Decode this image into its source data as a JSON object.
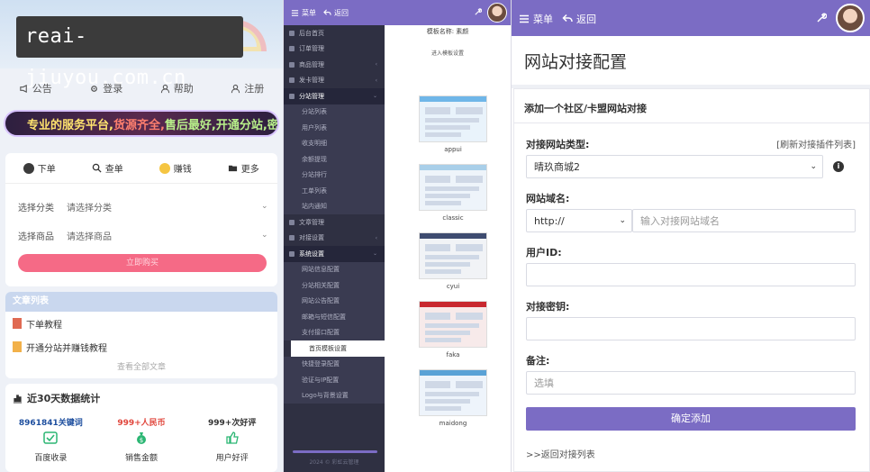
{
  "storefront": {
    "watermark": "reai-jiuyou.com.cn",
    "topnav": [
      {
        "label": "公告",
        "icon": "notice-icon"
      },
      {
        "label": "登录",
        "icon": "gear-icon"
      },
      {
        "label": "帮助",
        "icon": "user-icon"
      },
      {
        "label": "注册",
        "icon": "user-icon"
      }
    ],
    "marquee": {
      "part1": "专业的服务平台,",
      "part2": "货源齐全,",
      "part3": "售后最好,开通分站,密价"
    },
    "actions": [
      {
        "label": "下单",
        "icon": "avatar-icon"
      },
      {
        "label": "查单",
        "icon": "search-icon"
      },
      {
        "label": "赚钱",
        "icon": "smile-icon"
      },
      {
        "label": "更多",
        "icon": "folder-icon"
      }
    ],
    "select_category": {
      "label": "选择分类",
      "value": "请选择分类"
    },
    "select_product": {
      "label": "选择商品",
      "value": "请选择商品"
    },
    "buy_button": "立即购买",
    "articles": {
      "title": "文章列表",
      "items": [
        {
          "label": "下单教程",
          "color": "#e06a52"
        },
        {
          "label": "开通分站并赚钱教程",
          "color": "#f2b14a"
        }
      ],
      "more": "查看全部文章"
    },
    "stats": {
      "title": "近30天数据统计",
      "items": [
        {
          "value": "8961841关键词",
          "label": "百度收录",
          "color": "#1d4e9e"
        },
        {
          "value": "999+人民币",
          "label": "销售金额",
          "color": "#e0443a"
        },
        {
          "value": "999+次好评",
          "label": "用户好评",
          "color": "#333333"
        }
      ]
    }
  },
  "admin_sidebar": {
    "topbar": {
      "menu": "菜单",
      "back": "返回"
    },
    "items": [
      {
        "label": "后台首页",
        "type": "item"
      },
      {
        "label": "订单管理",
        "type": "item"
      },
      {
        "label": "商品管理",
        "type": "item",
        "arrow": "‹"
      },
      {
        "label": "发卡管理",
        "type": "item",
        "arrow": "‹"
      },
      {
        "label": "分站管理",
        "type": "group",
        "arrow": "⌄"
      },
      {
        "label": "分站列表",
        "type": "sub"
      },
      {
        "label": "用户列表",
        "type": "sub"
      },
      {
        "label": "收支明细",
        "type": "sub"
      },
      {
        "label": "余额提现",
        "type": "sub"
      },
      {
        "label": "分站排行",
        "type": "sub"
      },
      {
        "label": "工单列表",
        "type": "sub"
      },
      {
        "label": "站内通知",
        "type": "sub"
      },
      {
        "label": "文章管理",
        "type": "item"
      },
      {
        "label": "对接设置",
        "type": "item",
        "arrow": "‹"
      },
      {
        "label": "系统设置",
        "type": "group",
        "arrow": "⌄"
      },
      {
        "label": "网站信息配置",
        "type": "sub"
      },
      {
        "label": "分站相关配置",
        "type": "sub"
      },
      {
        "label": "网站公告配置",
        "type": "sub"
      },
      {
        "label": "邮箱与短信配置",
        "type": "sub"
      },
      {
        "label": "支付接口配置",
        "type": "sub"
      },
      {
        "label": "首页模板设置",
        "type": "active"
      },
      {
        "label": "快捷登录配置",
        "type": "sub"
      },
      {
        "label": "验证与IP配置",
        "type": "sub"
      },
      {
        "label": "Logo与背景设置",
        "type": "sub"
      }
    ],
    "footer": "2024 © 彩虹云管理",
    "content": {
      "template_title": "模板名称: 素颜",
      "enter_link": "进入模板设置",
      "templates": [
        "appui",
        "classic",
        "cyui",
        "faka",
        "maidong"
      ]
    }
  },
  "form_page": {
    "topbar": {
      "menu": "菜单",
      "back": "返回"
    },
    "title": "网站对接配置",
    "card_title": "添加一个社区/卡盟网站对接",
    "site_type": {
      "label": "对接网站类型:",
      "refresh_link": "[刷新对接插件列表]",
      "value": "晴玖商城2"
    },
    "domain": {
      "label": "网站域名:",
      "protocol": "http://",
      "placeholder": "输入对接网站域名"
    },
    "user_id": {
      "label": "用户ID:",
      "value": ""
    },
    "secret": {
      "label": "对接密钥:",
      "value": ""
    },
    "note": {
      "label": "备注:",
      "placeholder": "选填"
    },
    "submit": "确定添加",
    "back_link": ">>返回对接列表"
  }
}
